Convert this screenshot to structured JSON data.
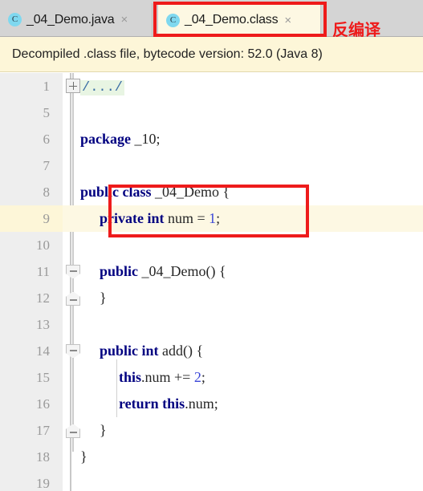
{
  "window": {
    "app": "IntelliJ IDEA editor"
  },
  "tabs": [
    {
      "label": "_04_Demo.java",
      "icon": "java-class-icon",
      "icon_letter": "C",
      "close_glyph": "×",
      "active": false
    },
    {
      "label": "_04_Demo.class",
      "icon": "java-class-icon",
      "icon_letter": "C",
      "close_glyph": "×",
      "active": true
    }
  ],
  "annotation": {
    "decompile_label": "反编译",
    "color": "#ee1b1b"
  },
  "banner": {
    "text": "Decompiled .class file, bytecode version: 52.0 (Java 8)",
    "background": "#fdf6d8"
  },
  "editor": {
    "caret_line": 9,
    "colors": {
      "keyword": "#000080",
      "number": "#3b46d8",
      "identifier": "#262626",
      "folded_comment_bg": "#e8f5e3",
      "caret_line_bg": "#fdf8e3",
      "gutter_bg": "#eeeeee"
    },
    "lines": [
      {
        "number": "1",
        "indent": 0,
        "text": "/.../",
        "kind": "folded-comment",
        "fold": "plus"
      },
      {
        "number": "5",
        "indent": 0,
        "text": "",
        "kind": "blank"
      },
      {
        "number": "6",
        "indent": 0,
        "text": "package _10;",
        "kind": "code"
      },
      {
        "number": "7",
        "indent": 0,
        "text": "",
        "kind": "blank"
      },
      {
        "number": "8",
        "indent": 0,
        "text": "public class _04_Demo {",
        "kind": "code"
      },
      {
        "number": "9",
        "indent": 1,
        "text": "private int num = 1;",
        "kind": "code"
      },
      {
        "number": "10",
        "indent": 0,
        "text": "",
        "kind": "blank"
      },
      {
        "number": "11",
        "indent": 1,
        "text": "public _04_Demo() {",
        "kind": "code",
        "fold": "start"
      },
      {
        "number": "12",
        "indent": 1,
        "text": "}",
        "kind": "code",
        "fold": "end"
      },
      {
        "number": "13",
        "indent": 0,
        "text": "",
        "kind": "blank"
      },
      {
        "number": "14",
        "indent": 1,
        "text": "public int add() {",
        "kind": "code",
        "fold": "start"
      },
      {
        "number": "15",
        "indent": 2,
        "text": "this.num += 2;",
        "kind": "code"
      },
      {
        "number": "16",
        "indent": 2,
        "text": "return this.num;",
        "kind": "code"
      },
      {
        "number": "17",
        "indent": 1,
        "text": "}",
        "kind": "code",
        "fold": "end"
      },
      {
        "number": "18",
        "indent": 0,
        "text": "}",
        "kind": "code"
      },
      {
        "number": "19",
        "indent": 0,
        "text": "",
        "kind": "blank"
      }
    ]
  },
  "highlight_boxes": [
    {
      "target": "active-tab",
      "color": "#ee1b1b"
    },
    {
      "target": "constructor",
      "color": "#ee1b1b"
    }
  ]
}
